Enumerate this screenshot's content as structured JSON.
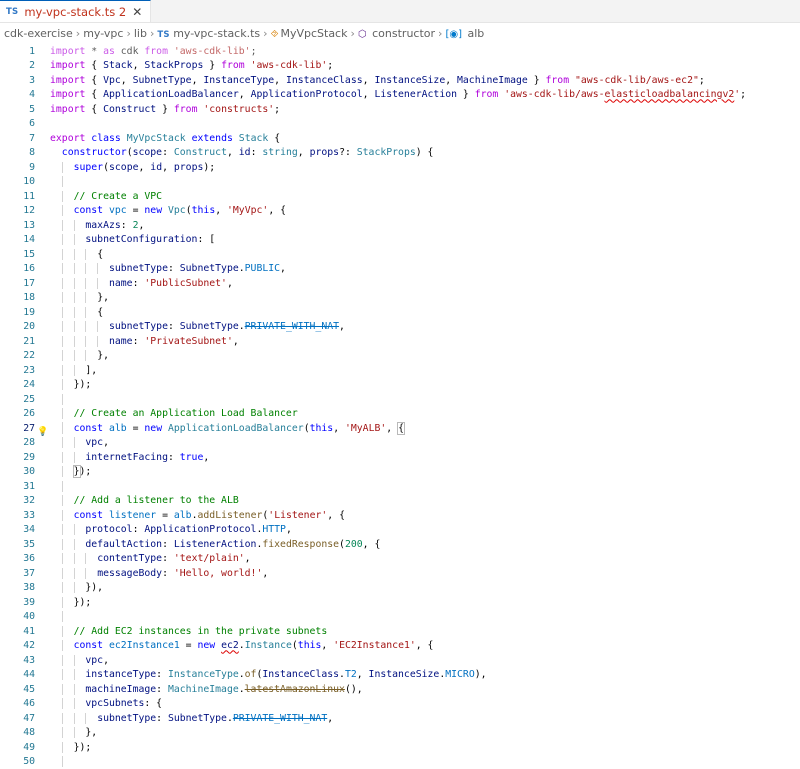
{
  "tab": {
    "badge": "TS",
    "name": "my-vpc-stack.ts",
    "modified": "2",
    "close": "✕"
  },
  "breadcrumb": {
    "items": [
      "cdk-exercise",
      "my-vpc",
      "lib",
      "my-vpc-stack.ts",
      "MyVpcStack",
      "constructor",
      "alb"
    ],
    "file_badge": "TS",
    "sep": "›"
  },
  "lines": [
    {
      "n": "1",
      "indent": 0,
      "t": [
        [
          "kwc faded",
          "import"
        ],
        [
          "faded",
          " * "
        ],
        [
          "kwc faded",
          "as"
        ],
        [
          "faded",
          " cdk "
        ],
        [
          "kwc faded",
          "from"
        ],
        [
          "faded",
          " "
        ],
        [
          "str faded",
          "'aws-cdk-lib'"
        ],
        [
          "faded",
          ";"
        ]
      ]
    },
    {
      "n": "2",
      "indent": 0,
      "t": [
        [
          "kwc",
          "import"
        ],
        [
          "",
          " { "
        ],
        [
          "prop",
          "Stack"
        ],
        [
          "",
          ", "
        ],
        [
          "prop",
          "StackProps"
        ],
        [
          "",
          " } "
        ],
        [
          "kwc",
          "from"
        ],
        [
          "",
          " "
        ],
        [
          "str",
          "'aws-cdk-lib'"
        ],
        [
          "",
          ";"
        ]
      ]
    },
    {
      "n": "3",
      "indent": 0,
      "t": [
        [
          "kwc",
          "import"
        ],
        [
          "",
          " { "
        ],
        [
          "prop",
          "Vpc"
        ],
        [
          "",
          ", "
        ],
        [
          "prop",
          "SubnetType"
        ],
        [
          "",
          ", "
        ],
        [
          "prop",
          "InstanceType"
        ],
        [
          "",
          ", "
        ],
        [
          "prop",
          "InstanceClass"
        ],
        [
          "",
          ", "
        ],
        [
          "prop",
          "InstanceSize"
        ],
        [
          "",
          ", "
        ],
        [
          "prop",
          "MachineImage"
        ],
        [
          "",
          " } "
        ],
        [
          "kwc",
          "from"
        ],
        [
          "",
          " "
        ],
        [
          "str",
          "\"aws-cdk-lib/aws-ec2\""
        ],
        [
          "",
          ";"
        ]
      ]
    },
    {
      "n": "4",
      "indent": 0,
      "t": [
        [
          "kwc",
          "import"
        ],
        [
          "",
          " { "
        ],
        [
          "prop",
          "ApplicationLoadBalancer"
        ],
        [
          "",
          ", "
        ],
        [
          "prop",
          "ApplicationProtocol"
        ],
        [
          "",
          ", "
        ],
        [
          "prop",
          "ListenerAction"
        ],
        [
          "",
          " } "
        ],
        [
          "kwc",
          "from"
        ],
        [
          "",
          " "
        ],
        [
          "str",
          "'aws-cdk-lib/aws-"
        ],
        [
          "str squig",
          "elasticloadbalancingv2"
        ],
        [
          "str",
          "'"
        ],
        [
          "",
          ";"
        ]
      ]
    },
    {
      "n": "5",
      "indent": 0,
      "t": [
        [
          "kwc",
          "import"
        ],
        [
          "",
          " { "
        ],
        [
          "prop",
          "Construct"
        ],
        [
          "",
          " } "
        ],
        [
          "kwc",
          "from"
        ],
        [
          "",
          " "
        ],
        [
          "str",
          "'constructs'"
        ],
        [
          "",
          ";"
        ]
      ]
    },
    {
      "n": "6",
      "indent": 0,
      "t": []
    },
    {
      "n": "7",
      "indent": 0,
      "t": [
        [
          "kwc",
          "export"
        ],
        [
          "",
          " "
        ],
        [
          "kw",
          "class"
        ],
        [
          "",
          " "
        ],
        [
          "cls",
          "MyVpcStack"
        ],
        [
          "",
          " "
        ],
        [
          "kw",
          "extends"
        ],
        [
          "",
          " "
        ],
        [
          "cls",
          "Stack"
        ],
        [
          "",
          " {"
        ]
      ]
    },
    {
      "n": "8",
      "indent": 1,
      "t": [
        [
          "kw",
          "constructor"
        ],
        [
          "",
          "("
        ],
        [
          "prop",
          "scope"
        ],
        [
          "",
          ": "
        ],
        [
          "cls",
          "Construct"
        ],
        [
          "",
          ", "
        ],
        [
          "prop",
          "id"
        ],
        [
          "",
          ": "
        ],
        [
          "cls",
          "string"
        ],
        [
          "",
          ", "
        ],
        [
          "prop",
          "props"
        ],
        [
          "",
          "?: "
        ],
        [
          "cls",
          "StackProps"
        ],
        [
          "",
          ") {"
        ]
      ]
    },
    {
      "n": "9",
      "indent": 2,
      "t": [
        [
          "kw",
          "super"
        ],
        [
          "",
          "("
        ],
        [
          "prop",
          "scope"
        ],
        [
          "",
          ", "
        ],
        [
          "prop",
          "id"
        ],
        [
          "",
          ", "
        ],
        [
          "prop",
          "props"
        ],
        [
          "",
          ");"
        ]
      ]
    },
    {
      "n": "10",
      "indent": 2,
      "t": []
    },
    {
      "n": "11",
      "indent": 2,
      "t": [
        [
          "cmt",
          "// Create a VPC"
        ]
      ]
    },
    {
      "n": "12",
      "indent": 2,
      "t": [
        [
          "kw",
          "const"
        ],
        [
          "",
          " "
        ],
        [
          "enm",
          "vpc"
        ],
        [
          "",
          " = "
        ],
        [
          "kw",
          "new"
        ],
        [
          "",
          " "
        ],
        [
          "cls",
          "Vpc"
        ],
        [
          "",
          "("
        ],
        [
          "kw",
          "this"
        ],
        [
          "",
          ", "
        ],
        [
          "str",
          "'MyVpc'"
        ],
        [
          "",
          ", {"
        ]
      ]
    },
    {
      "n": "13",
      "indent": 3,
      "t": [
        [
          "prop",
          "maxAzs"
        ],
        [
          "",
          ": "
        ],
        [
          "num",
          "2"
        ],
        [
          "",
          ","
        ]
      ]
    },
    {
      "n": "14",
      "indent": 3,
      "t": [
        [
          "prop",
          "subnetConfiguration"
        ],
        [
          "",
          ": ["
        ]
      ]
    },
    {
      "n": "15",
      "indent": 4,
      "t": [
        [
          "",
          "{"
        ]
      ]
    },
    {
      "n": "16",
      "indent": 5,
      "t": [
        [
          "prop",
          "subnetType"
        ],
        [
          "",
          ": "
        ],
        [
          "prop",
          "SubnetType"
        ],
        [
          "",
          "."
        ],
        [
          "enm",
          "PUBLIC"
        ],
        [
          "",
          ","
        ]
      ]
    },
    {
      "n": "17",
      "indent": 5,
      "t": [
        [
          "prop",
          "name"
        ],
        [
          "",
          ": "
        ],
        [
          "str",
          "'PublicSubnet'"
        ],
        [
          "",
          ","
        ]
      ]
    },
    {
      "n": "18",
      "indent": 4,
      "t": [
        [
          "",
          "},"
        ]
      ]
    },
    {
      "n": "19",
      "indent": 4,
      "t": [
        [
          "",
          "{"
        ]
      ]
    },
    {
      "n": "20",
      "indent": 5,
      "t": [
        [
          "prop",
          "subnetType"
        ],
        [
          "",
          ": "
        ],
        [
          "prop",
          "SubnetType"
        ],
        [
          "",
          "."
        ],
        [
          "enm dep",
          "PRIVATE_WITH_NAT"
        ],
        [
          "",
          ","
        ]
      ]
    },
    {
      "n": "21",
      "indent": 5,
      "t": [
        [
          "prop",
          "name"
        ],
        [
          "",
          ": "
        ],
        [
          "str",
          "'PrivateSubnet'"
        ],
        [
          "",
          ","
        ]
      ]
    },
    {
      "n": "22",
      "indent": 4,
      "t": [
        [
          "",
          "},"
        ]
      ]
    },
    {
      "n": "23",
      "indent": 3,
      "t": [
        [
          "",
          "],"
        ]
      ]
    },
    {
      "n": "24",
      "indent": 2,
      "t": [
        [
          "",
          "});"
        ]
      ]
    },
    {
      "n": "25",
      "indent": 2,
      "t": []
    },
    {
      "n": "26",
      "indent": 2,
      "t": [
        [
          "cmt",
          "// Create an Application Load Balancer"
        ]
      ]
    },
    {
      "n": "27",
      "indent": 2,
      "active": true,
      "t": [
        [
          "kw",
          "const"
        ],
        [
          "",
          " "
        ],
        [
          "enm",
          "alb"
        ],
        [
          "",
          " = "
        ],
        [
          "kw",
          "new"
        ],
        [
          "",
          " "
        ],
        [
          "cls",
          "ApplicationLoadBalancer"
        ],
        [
          "",
          "("
        ],
        [
          "kw",
          "this"
        ],
        [
          "",
          ", "
        ],
        [
          "str",
          "'MyALB'"
        ],
        [
          "",
          ", "
        ],
        [
          "bracket-hl",
          "{"
        ]
      ]
    },
    {
      "n": "28",
      "indent": 3,
      "t": [
        [
          "prop",
          "vpc"
        ],
        [
          "",
          ","
        ]
      ]
    },
    {
      "n": "29",
      "indent": 3,
      "t": [
        [
          "prop",
          "internetFacing"
        ],
        [
          "",
          ": "
        ],
        [
          "kw",
          "true"
        ],
        [
          "",
          ","
        ]
      ]
    },
    {
      "n": "30",
      "indent": 2,
      "t": [
        [
          "bracket-hl",
          "}"
        ],
        [
          "",
          ");"
        ]
      ]
    },
    {
      "n": "31",
      "indent": 2,
      "t": []
    },
    {
      "n": "32",
      "indent": 2,
      "t": [
        [
          "cmt",
          "// Add a listener to the ALB"
        ]
      ]
    },
    {
      "n": "33",
      "indent": 2,
      "t": [
        [
          "kw",
          "const"
        ],
        [
          "",
          " "
        ],
        [
          "enm",
          "listener"
        ],
        [
          "",
          " = "
        ],
        [
          "enm",
          "alb"
        ],
        [
          "",
          "."
        ],
        [
          "fn",
          "addListener"
        ],
        [
          "",
          "("
        ],
        [
          "str",
          "'Listener'"
        ],
        [
          "",
          ", {"
        ]
      ]
    },
    {
      "n": "34",
      "indent": 3,
      "t": [
        [
          "prop",
          "protocol"
        ],
        [
          "",
          ": "
        ],
        [
          "prop",
          "ApplicationProtocol"
        ],
        [
          "",
          "."
        ],
        [
          "enm",
          "HTTP"
        ],
        [
          "",
          ","
        ]
      ]
    },
    {
      "n": "35",
      "indent": 3,
      "t": [
        [
          "prop",
          "defaultAction"
        ],
        [
          "",
          ": "
        ],
        [
          "prop",
          "ListenerAction"
        ],
        [
          "",
          "."
        ],
        [
          "fn",
          "fixedResponse"
        ],
        [
          "",
          "("
        ],
        [
          "num",
          "200"
        ],
        [
          "",
          ", {"
        ]
      ]
    },
    {
      "n": "36",
      "indent": 4,
      "t": [
        [
          "prop",
          "contentType"
        ],
        [
          "",
          ": "
        ],
        [
          "str",
          "'text/plain'"
        ],
        [
          "",
          ","
        ]
      ]
    },
    {
      "n": "37",
      "indent": 4,
      "t": [
        [
          "prop",
          "messageBody"
        ],
        [
          "",
          ": "
        ],
        [
          "str",
          "'Hello, world!'"
        ],
        [
          "",
          ","
        ]
      ]
    },
    {
      "n": "38",
      "indent": 3,
      "t": [
        [
          "",
          "}),"
        ]
      ]
    },
    {
      "n": "39",
      "indent": 2,
      "t": [
        [
          "",
          "});"
        ]
      ]
    },
    {
      "n": "40",
      "indent": 2,
      "t": []
    },
    {
      "n": "41",
      "indent": 2,
      "t": [
        [
          "cmt",
          "// Add EC2 instances in the private subnets"
        ]
      ]
    },
    {
      "n": "42",
      "indent": 2,
      "t": [
        [
          "kw",
          "const"
        ],
        [
          "",
          " "
        ],
        [
          "enm",
          "ec2Instance1"
        ],
        [
          "",
          " = "
        ],
        [
          "kw",
          "new"
        ],
        [
          "",
          " "
        ],
        [
          "prop squig",
          "ec2"
        ],
        [
          "",
          "."
        ],
        [
          "cls",
          "Instance"
        ],
        [
          "",
          "("
        ],
        [
          "kw",
          "this"
        ],
        [
          "",
          ", "
        ],
        [
          "str",
          "'EC2Instance1'"
        ],
        [
          "",
          ", {"
        ]
      ]
    },
    {
      "n": "43",
      "indent": 3,
      "t": [
        [
          "prop",
          "vpc"
        ],
        [
          "",
          ","
        ]
      ]
    },
    {
      "n": "44",
      "indent": 3,
      "t": [
        [
          "prop",
          "instanceType"
        ],
        [
          "",
          ": "
        ],
        [
          "cls",
          "InstanceType"
        ],
        [
          "",
          "."
        ],
        [
          "fn",
          "of"
        ],
        [
          "",
          "("
        ],
        [
          "prop",
          "InstanceClass"
        ],
        [
          "",
          "."
        ],
        [
          "enm",
          "T2"
        ],
        [
          "",
          ", "
        ],
        [
          "prop",
          "InstanceSize"
        ],
        [
          "",
          "."
        ],
        [
          "enm",
          "MICRO"
        ],
        [
          "",
          "),"
        ]
      ]
    },
    {
      "n": "45",
      "indent": 3,
      "t": [
        [
          "prop",
          "machineImage"
        ],
        [
          "",
          ": "
        ],
        [
          "cls",
          "MachineImage"
        ],
        [
          "",
          "."
        ],
        [
          "fn dep",
          "latestAmazonLinux"
        ],
        [
          "",
          "(),"
        ]
      ]
    },
    {
      "n": "46",
      "indent": 3,
      "t": [
        [
          "prop",
          "vpcSubnets"
        ],
        [
          "",
          ": {"
        ]
      ]
    },
    {
      "n": "47",
      "indent": 4,
      "t": [
        [
          "prop",
          "subnetType"
        ],
        [
          "",
          ": "
        ],
        [
          "prop",
          "SubnetType"
        ],
        [
          "",
          "."
        ],
        [
          "enm dep",
          "PRIVATE_WITH_NAT"
        ],
        [
          "",
          ","
        ]
      ]
    },
    {
      "n": "48",
      "indent": 3,
      "t": [
        [
          "",
          "},"
        ]
      ]
    },
    {
      "n": "49",
      "indent": 2,
      "t": [
        [
          "",
          "});"
        ]
      ]
    },
    {
      "n": "50",
      "indent": 2,
      "t": []
    }
  ]
}
